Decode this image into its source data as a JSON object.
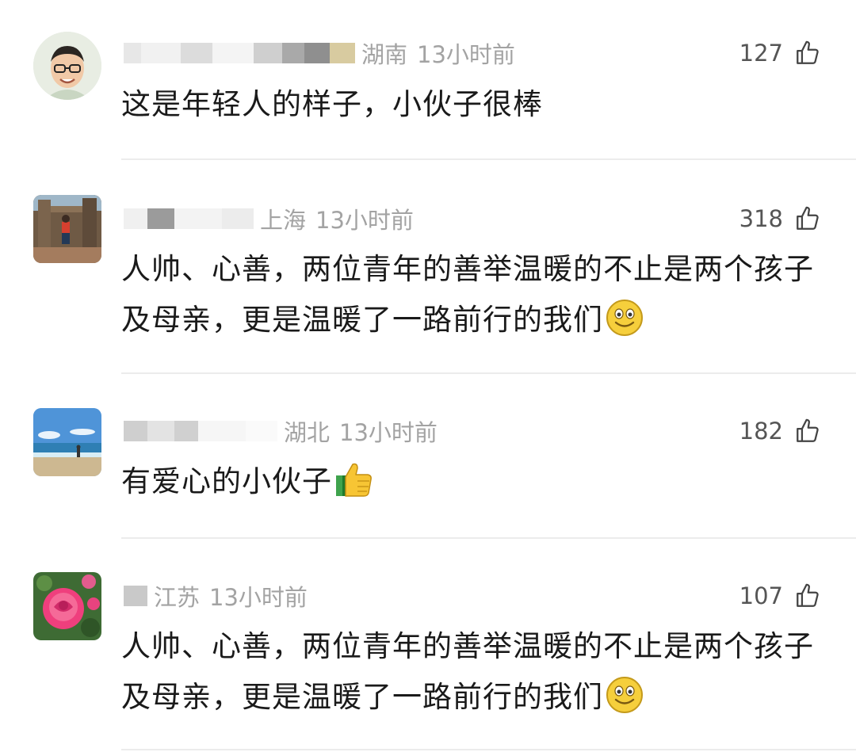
{
  "comments": [
    {
      "location": "湖南",
      "time": "13小时前",
      "likes": "127",
      "text": "这是年轻人的样子，小伙子很棒",
      "avatar": "man-with-glasses-avatar",
      "emoji": null
    },
    {
      "location": "上海",
      "time": "13小时前",
      "likes": "318",
      "text": "人帅、心善，两位青年的善举温暖的不止是两个孩子及母亲，更是温暖了一路前行的我们",
      "avatar": "temple-ruins-photo-avatar",
      "emoji": "smile-emoji"
    },
    {
      "location": "湖北",
      "time": "13小时前",
      "likes": "182",
      "text": "有爱心的小伙子",
      "avatar": "beach-photo-avatar",
      "emoji": "thumbs-up-emoji"
    },
    {
      "location": "江苏",
      "time": "13小时前",
      "likes": "107",
      "text": "人帅、心善，两位青年的善举温暖的不止是两个孩子及母亲，更是温暖了一路前行的我们",
      "avatar": "pink-rose-avatar",
      "emoji": "smile-emoji"
    }
  ],
  "icons": {
    "like": "thumbs-up-outline-icon"
  },
  "colors": {
    "meta": "#a3a3a3",
    "text": "#1a1a1a",
    "divider": "#ececec"
  }
}
